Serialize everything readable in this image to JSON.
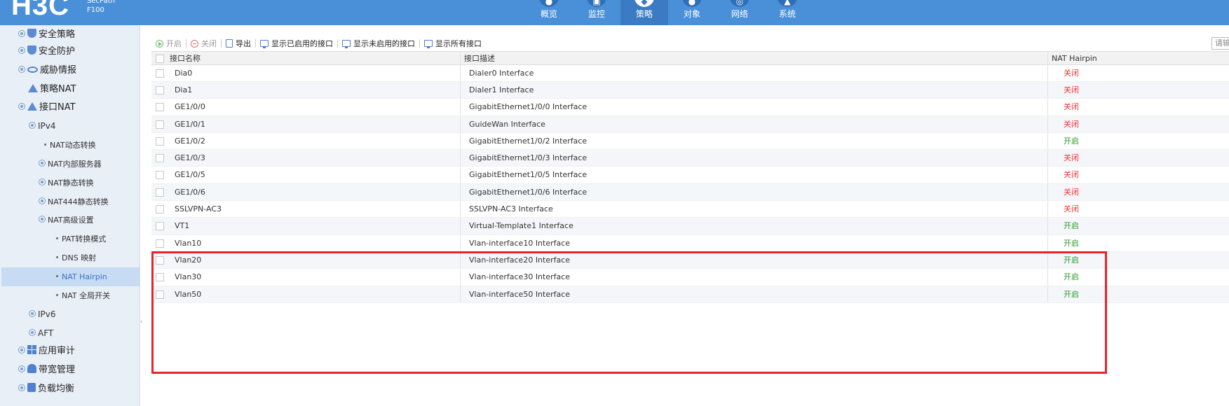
{
  "header": {
    "logo": "H3C",
    "product_line1": "SecPath",
    "product_line2": "F100",
    "nav": [
      {
        "label": "概览",
        "icon": "dashboard-icon",
        "active": false
      },
      {
        "label": "监控",
        "icon": "monitor-icon",
        "active": false
      },
      {
        "label": "策略",
        "icon": "shield-icon",
        "active": true
      },
      {
        "label": "对象",
        "icon": "object-icon",
        "active": false
      },
      {
        "label": "网络",
        "icon": "globe-icon",
        "active": false
      },
      {
        "label": "系统",
        "icon": "settings-icon",
        "active": false
      }
    ]
  },
  "sidebar": {
    "items": [
      {
        "label": "安全策略"
      },
      {
        "label": "安全防护"
      },
      {
        "label": "威胁情报"
      },
      {
        "label": "策略NAT"
      },
      {
        "label": "接口NAT"
      },
      {
        "label": "IPv4"
      },
      {
        "label": "NAT动态转换"
      },
      {
        "label": "NAT内部服务器"
      },
      {
        "label": "NAT静态转换"
      },
      {
        "label": "NAT444静态转换"
      },
      {
        "label": "NAT高级设置"
      },
      {
        "label": "PAT转换模式"
      },
      {
        "label": "DNS 映射"
      },
      {
        "label": "NAT Hairpin"
      },
      {
        "label": "NAT 全局开关"
      },
      {
        "label": "IPv6"
      },
      {
        "label": "AFT"
      },
      {
        "label": "应用审计"
      },
      {
        "label": "带宽管理"
      },
      {
        "label": "负载均衡"
      }
    ],
    "active_label": "NAT Hairpin"
  },
  "toolbar": {
    "enable": "开启",
    "disable": "关闭",
    "export": "导出",
    "show_enabled": "显示已启用的接口",
    "show_disabled": "显示未启用的接口",
    "show_all": "显示所有接口",
    "search_placeholder": "请输"
  },
  "table": {
    "headers": {
      "name": "接口名称",
      "desc": "接口描述",
      "nat": "NAT Hairpin"
    },
    "rows": [
      {
        "name": "Dia0",
        "desc": "Dialer0 Interface",
        "status": "关闭"
      },
      {
        "name": "Dia1",
        "desc": "Dialer1 Interface",
        "status": "关闭"
      },
      {
        "name": "GE1/0/0",
        "desc": "GigabitEthernet1/0/0 Interface",
        "status": "关闭"
      },
      {
        "name": "GE1/0/1",
        "desc": "GuideWan Interface",
        "status": "关闭"
      },
      {
        "name": "GE1/0/2",
        "desc": "GigabitEthernet1/0/2 Interface",
        "status": "开启"
      },
      {
        "name": "GE1/0/3",
        "desc": "GigabitEthernet1/0/3 Interface",
        "status": "关闭"
      },
      {
        "name": "GE1/0/5",
        "desc": "GigabitEthernet1/0/5 Interface",
        "status": "关闭"
      },
      {
        "name": "GE1/0/6",
        "desc": "GigabitEthernet1/0/6 Interface",
        "status": "关闭"
      },
      {
        "name": "SSLVPN-AC3",
        "desc": "SSLVPN-AC3 Interface",
        "status": "关闭"
      },
      {
        "name": "VT1",
        "desc": "Virtual-Template1 Interface",
        "status": "开启"
      },
      {
        "name": "Vlan10",
        "desc": "Vlan-interface10 Interface",
        "status": "开启"
      },
      {
        "name": "Vlan20",
        "desc": "Vlan-interface20 Interface",
        "status": "开启"
      },
      {
        "name": "Vlan30",
        "desc": "Vlan-interface30 Interface",
        "status": "开启"
      },
      {
        "name": "Vlan50",
        "desc": "Vlan-interface50 Interface",
        "status": "开启"
      }
    ]
  },
  "colors": {
    "header_bg": "#4a90d9",
    "status_on": "#2a9a2a",
    "status_off": "#e33333",
    "highlight_border": "#e8232a"
  }
}
